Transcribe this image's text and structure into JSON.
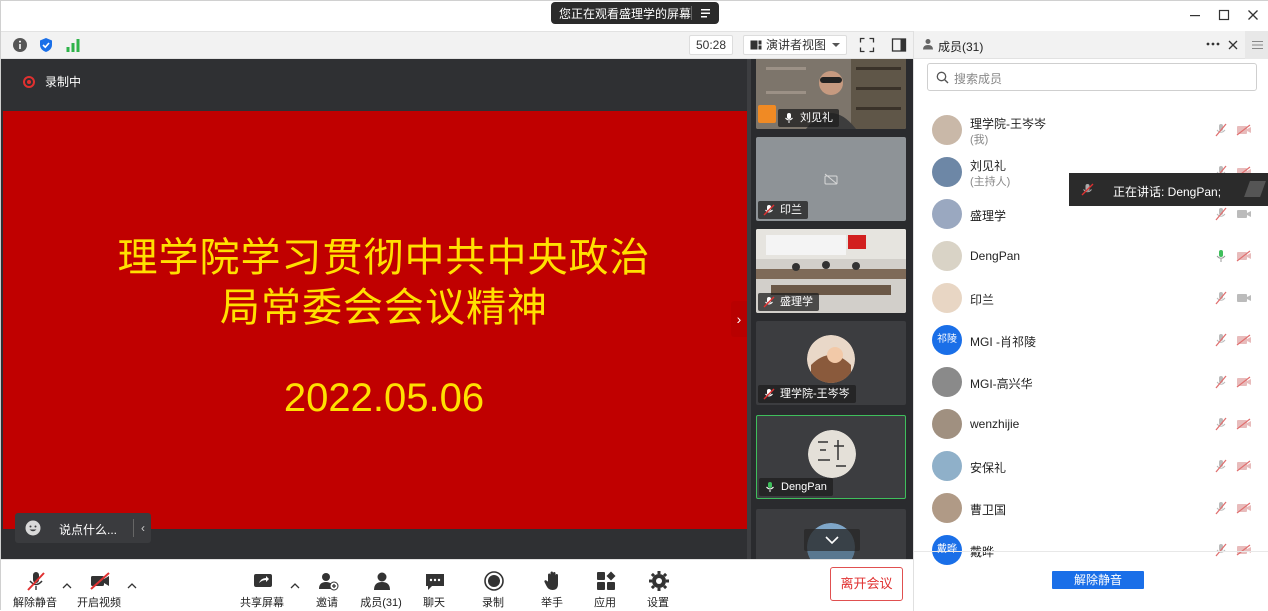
{
  "titlebar": {
    "share_notice": "您正在观看盛理学的屏幕"
  },
  "topbar": {
    "timer": "50:28",
    "view_mode": "演讲者视图"
  },
  "stage": {
    "recording_label": "录制中",
    "slide_title_line1": "理学院学习贯彻中共中央政治",
    "slide_title_line2": "局常委会会议精神",
    "slide_date": "2022.05.06",
    "chat_placeholder": "说点什么...",
    "collapse_arrow": "›"
  },
  "thumbnails": [
    {
      "name": "刘见礼"
    },
    {
      "name": "印兰"
    },
    {
      "name": "盛理学"
    },
    {
      "name": "理学院-王岑岑"
    },
    {
      "name": "DengPan"
    }
  ],
  "bottombar": {
    "unmute": "解除静音",
    "start_video": "开启视频",
    "share_screen": "共享屏幕",
    "invite": "邀请",
    "members": "成员(31)",
    "chat": "聊天",
    "record": "录制",
    "raise_hand": "举手",
    "apps": "应用",
    "settings": "设置",
    "leave": "离开会议"
  },
  "panel": {
    "title": "成员(31)",
    "search_placeholder": "搜索成员",
    "unmute_all": "解除静音",
    "tooltip": "正在讲话: DengPan;",
    "members": [
      {
        "name": "理学院-王岑岑",
        "sub": "(我)"
      },
      {
        "name": "刘见礼",
        "sub": "(主持人)"
      },
      {
        "name": "盛理学",
        "sub": ""
      },
      {
        "name": "DengPan",
        "sub": ""
      },
      {
        "name": "印兰",
        "sub": ""
      },
      {
        "name": "MGI -肖祁陵",
        "sub": "",
        "avatar_text": "祁陵"
      },
      {
        "name": "MGI-高兴华",
        "sub": ""
      },
      {
        "name": "wenzhijie",
        "sub": ""
      },
      {
        "name": "安保礼",
        "sub": ""
      },
      {
        "name": "曹卫国",
        "sub": ""
      },
      {
        "name": "戴晔",
        "sub": "",
        "avatar_text": "戴晔"
      }
    ]
  },
  "colors": {
    "slide_bg": "#c00000",
    "slide_text": "#ffe000",
    "accent_blue": "#1a6fe8",
    "leave_red": "#e03030",
    "active_green": "#3fbf5c"
  }
}
